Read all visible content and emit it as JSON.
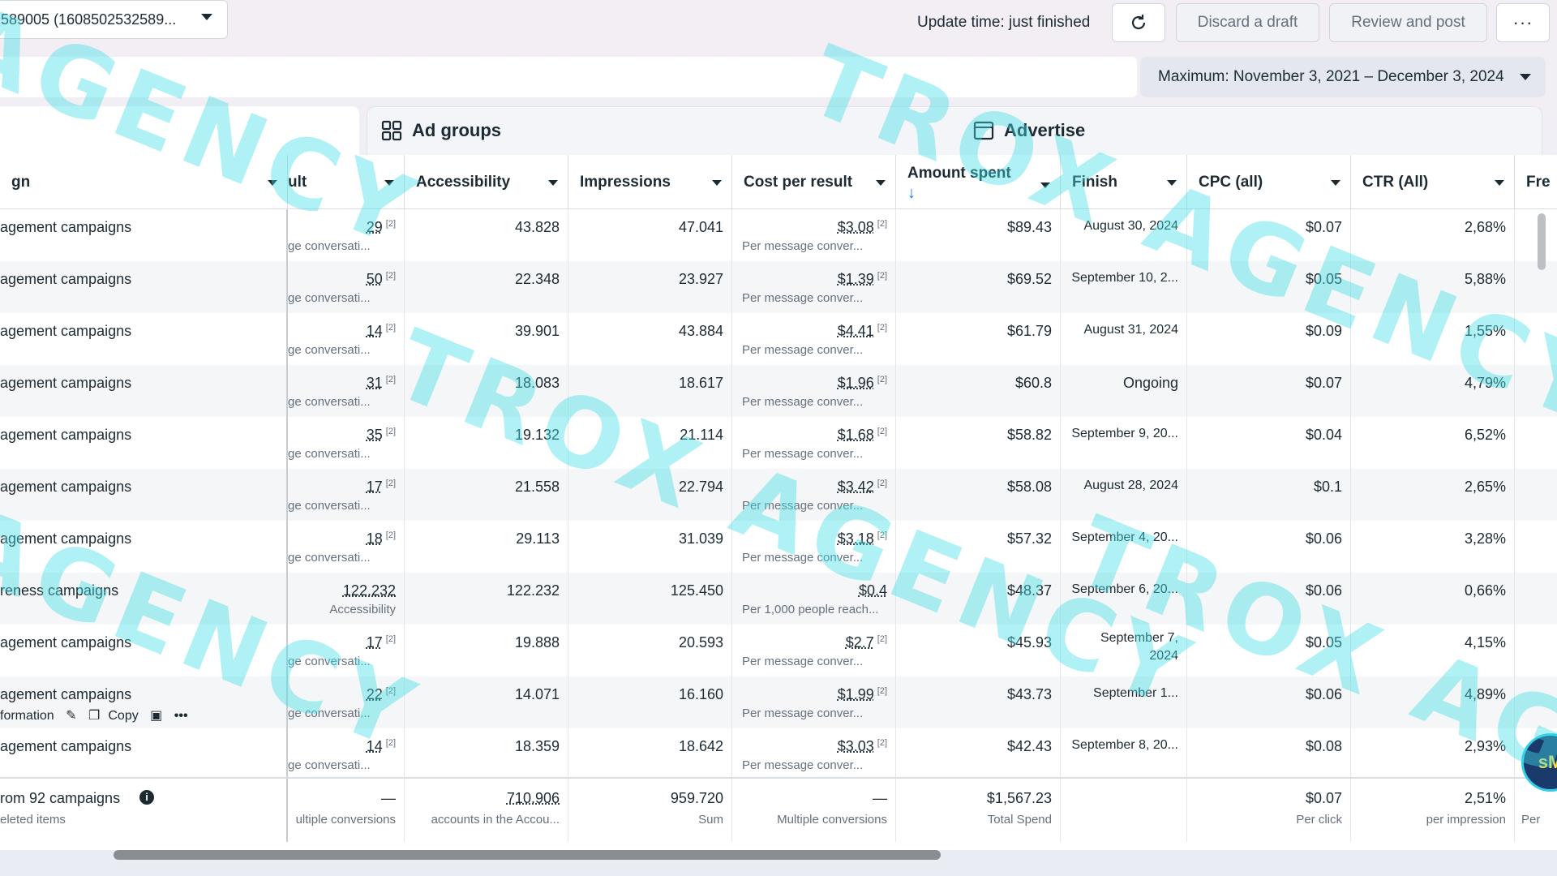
{
  "topbar": {
    "account": "589005 (1608502532589...",
    "update_time": "Update time: just finished",
    "discard": "Discard a draft",
    "review": "Review and post",
    "more": "···"
  },
  "daterange": "Maximum: November 3, 2021 – December 3, 2024",
  "tabs": {
    "adgroups": "Ad groups",
    "advertise": "Advertise"
  },
  "headers": {
    "campaign": "gn",
    "result": "ult",
    "accessibility": "Accessibility",
    "impressions": "Impressions",
    "cost": "Cost per result",
    "spent": "Amount spent",
    "finish": "Finish",
    "cpc": "CPC (all)",
    "ctr": "CTR (All)",
    "freq": "Fre"
  },
  "rows": [
    {
      "name": "agement campaigns",
      "result": "29",
      "result_sub": "ge conversati...",
      "acc": "43.828",
      "imp": "47.041",
      "cost": "$3.08",
      "cost_sub": "Per message conver...",
      "spent": "$89.43",
      "finish": "August 30, 2024",
      "cpc": "$0.07",
      "ctr": "2,68%"
    },
    {
      "name": "agement campaigns",
      "result": "50",
      "result_sub": "ge conversati...",
      "acc": "22.348",
      "imp": "23.927",
      "cost": "$1.39",
      "cost_sub": "Per message conver...",
      "spent": "$69.52",
      "finish": "September 10, 2...",
      "cpc": "$0.05",
      "ctr": "5,88%"
    },
    {
      "name": "agement campaigns",
      "result": "14",
      "result_sub": "ge conversati...",
      "acc": "39.901",
      "imp": "43.884",
      "cost": "$4.41",
      "cost_sub": "Per message conver...",
      "spent": "$61.79",
      "finish": "August 31, 2024",
      "cpc": "$0.09",
      "ctr": "1,55%"
    },
    {
      "name": "agement campaigns",
      "result": "31",
      "result_sub": "ge conversati...",
      "acc": "18.083",
      "imp": "18.617",
      "cost": "$1.96",
      "cost_sub": "Per message conver...",
      "spent": "$60.8",
      "finish": "Ongoing",
      "cpc": "$0.07",
      "ctr": "4,79%"
    },
    {
      "name": "agement campaigns",
      "result": "35",
      "result_sub": "ge conversati...",
      "acc": "19.132",
      "imp": "21.114",
      "cost": "$1.68",
      "cost_sub": "Per message conver...",
      "spent": "$58.82",
      "finish": "September 9, 20...",
      "cpc": "$0.04",
      "ctr": "6,52%"
    },
    {
      "name": "agement campaigns",
      "result": "17",
      "result_sub": "ge conversati...",
      "acc": "21.558",
      "imp": "22.794",
      "cost": "$3.42",
      "cost_sub": "Per message conver...",
      "spent": "$58.08",
      "finish": "August 28, 2024",
      "cpc": "$0.1",
      "ctr": "2,65%"
    },
    {
      "name": "agement campaigns",
      "result": "18",
      "result_sub": "ge conversati...",
      "acc": "29.113",
      "imp": "31.039",
      "cost": "$3.18",
      "cost_sub": "Per message conver...",
      "spent": "$57.32",
      "finish": "September 4, 20...",
      "cpc": "$0.06",
      "ctr": "3,28%"
    },
    {
      "name": "reness campaigns",
      "result": "122.232",
      "result_sub": "Accessibility",
      "acc": "122.232",
      "imp": "125.450",
      "cost": "$0.4",
      "cost_sub": "Per 1,000 people reach...",
      "spent": "$48.37",
      "finish": "September 6, 20...",
      "cpc": "$0.06",
      "ctr": "0,66%"
    },
    {
      "name": "agement campaigns",
      "result": "17",
      "result_sub": "ge conversati...",
      "acc": "19.888",
      "imp": "20.593",
      "cost": "$2.7",
      "cost_sub": "Per message conver...",
      "spent": "$45.93",
      "finish": "September 7,",
      "finish2": "2024",
      "cpc": "$0.05",
      "ctr": "4,15%"
    },
    {
      "name": "agement campaigns",
      "result": "22",
      "result_sub": "ge conversati...",
      "acc": "14.071",
      "imp": "16.160",
      "cost": "$1.99",
      "cost_sub": "Per message conver...",
      "spent": "$43.73",
      "finish": "September 1...",
      "cpc": "$0.06",
      "ctr": "4,89%"
    },
    {
      "name": "agement campaigns",
      "result": "14",
      "result_sub": "ge conversati...",
      "acc": "18.359",
      "imp": "18.642",
      "cost": "$3.03",
      "cost_sub": "Per message conver...",
      "spent": "$42.43",
      "finish": "September 8, 20...",
      "cpc": "$0.08",
      "ctr": "2,93%"
    }
  ],
  "row_tools": {
    "info": "formation",
    "copy": "Copy"
  },
  "footer": {
    "name": "rom 92 campaigns",
    "name_sub": "eleted items",
    "result": "—",
    "result_sub": "ultiple conversions",
    "acc": "710.906",
    "acc_sub": "accounts in the Accou...",
    "imp": "959.720",
    "imp_sub": "Sum",
    "cost": "—",
    "cost_sub": "Multiple conversions",
    "spent": "$1,567.23",
    "spent_sub": "Total Spend",
    "cpc": "$0.07",
    "cpc_sub": "Per click",
    "ctr": "2,51%",
    "ctr_sub": "per impression",
    "freq_sub": "Per"
  },
  "sup_mark": "[2]",
  "watermark": [
    "AGENCY",
    "TROX AGENCY",
    "TROX AGENCY",
    "AGENCY",
    "TROX AGE",
    "TROX",
    "Y"
  ],
  "avatar": "sM",
  "colors": {
    "link": "#1b5fb4",
    "watermark": "#40dee8",
    "accent": "#1877f2"
  }
}
